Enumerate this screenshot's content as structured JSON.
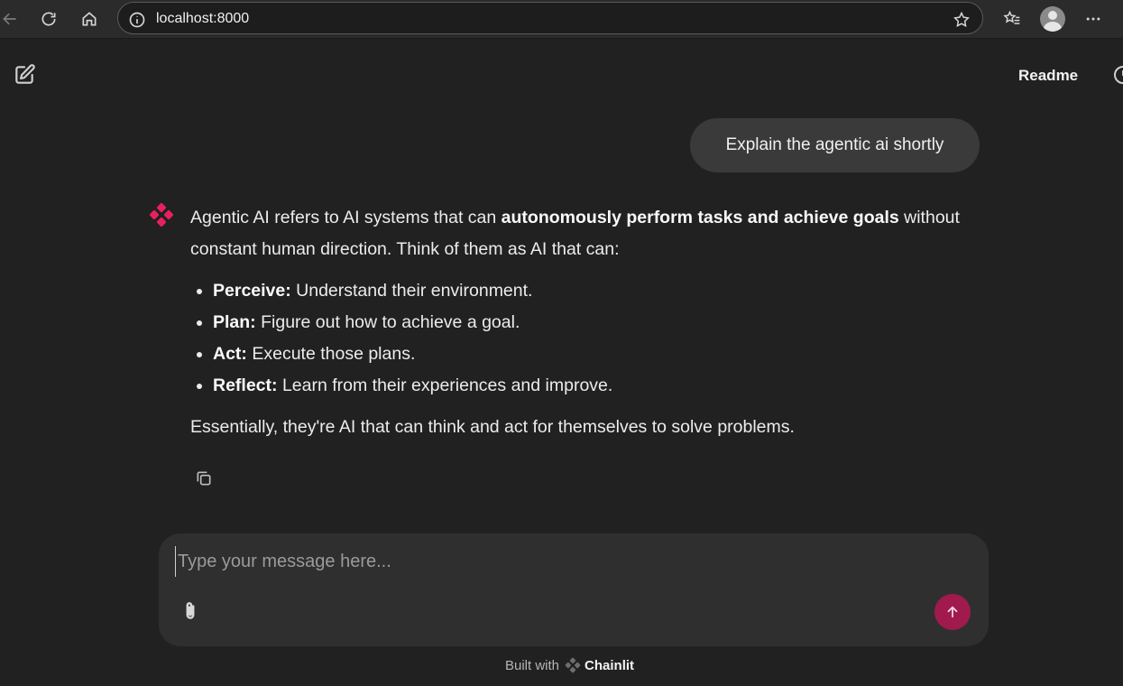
{
  "browser": {
    "url": "localhost:8000"
  },
  "header": {
    "readme_label": "Readme"
  },
  "conversation": {
    "user_message": "Explain the agentic ai shortly",
    "assistant": {
      "intro_prefix": "Agentic AI refers to AI systems that can ",
      "intro_bold": "autonomously perform tasks and achieve goals",
      "intro_suffix": " without constant human direction.  Think of them as AI that can:",
      "bullets": [
        {
          "term": "Perceive:",
          "text": " Understand their environment."
        },
        {
          "term": "Plan:",
          "text": " Figure out how to achieve a goal."
        },
        {
          "term": "Act:",
          "text": " Execute those plans."
        },
        {
          "term": "Reflect:",
          "text": " Learn from their experiences and improve."
        }
      ],
      "conclusion": "Essentially, they're AI that can think and act for themselves to solve problems."
    }
  },
  "composer": {
    "placeholder": "Type your message here..."
  },
  "footer": {
    "built_with": "Built with",
    "brand": "Chainlit"
  },
  "colors": {
    "background": "#212121",
    "accent": "#e8205f",
    "send_button": "#a01a4d"
  },
  "icons": [
    "back-icon",
    "reload-icon",
    "home-icon",
    "info-icon",
    "star-icon",
    "favorites-icon",
    "profile-icon",
    "more-icon",
    "new-chat-icon",
    "history-icon",
    "assistant-logo-icon",
    "copy-icon",
    "paperclip-icon",
    "arrow-up-icon",
    "chainlit-logo-icon"
  ]
}
